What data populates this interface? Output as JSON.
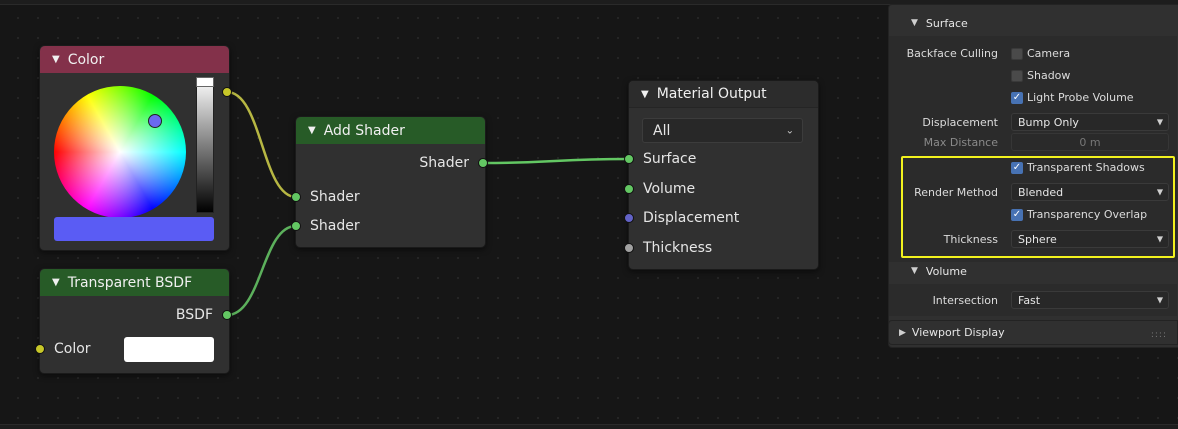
{
  "nodes": {
    "color": {
      "title": "Color",
      "swatch_color": "#5a5cf4"
    },
    "transparent_bsdf": {
      "title": "Transparent BSDF",
      "output_label": "BSDF",
      "color_label": "Color",
      "color_value": "#ffffff"
    },
    "add_shader": {
      "title": "Add Shader",
      "output_label": "Shader",
      "input1_label": "Shader",
      "input2_label": "Shader"
    },
    "material_output": {
      "title": "Material Output",
      "target": "All",
      "surface_label": "Surface",
      "volume_label": "Volume",
      "displacement_label": "Displacement",
      "thickness_label": "Thickness"
    }
  },
  "properties": {
    "surface": {
      "title": "Surface",
      "backface_culling_label": "Backface Culling",
      "camera_label": "Camera",
      "camera_checked": false,
      "shadow_label": "Shadow",
      "shadow_checked": false,
      "light_probe_label": "Light Probe Volume",
      "light_probe_checked": true,
      "displacement_label": "Displacement",
      "displacement_value": "Bump Only",
      "max_distance_label": "Max Distance",
      "max_distance_value": "0 m",
      "transparent_shadows_label": "Transparent Shadows",
      "transparent_shadows_checked": true,
      "render_method_label": "Render Method",
      "render_method_value": "Blended",
      "transparency_overlap_label": "Transparency Overlap",
      "transparency_overlap_checked": true,
      "thickness_label": "Thickness",
      "thickness_value": "Sphere"
    },
    "volume": {
      "title": "Volume",
      "intersection_label": "Intersection",
      "intersection_value": "Fast"
    },
    "viewport_display": {
      "title": "Viewport Display"
    }
  },
  "colors": {
    "color_header": "#83314a",
    "shader_header": "#275b27",
    "socket_yellow": "#c7c729",
    "socket_green": "#63c763",
    "socket_blue": "#6363c7",
    "socket_gray": "#a1a1a1",
    "highlight": "#f2f21e",
    "checkbox_on": "#4772b3"
  }
}
